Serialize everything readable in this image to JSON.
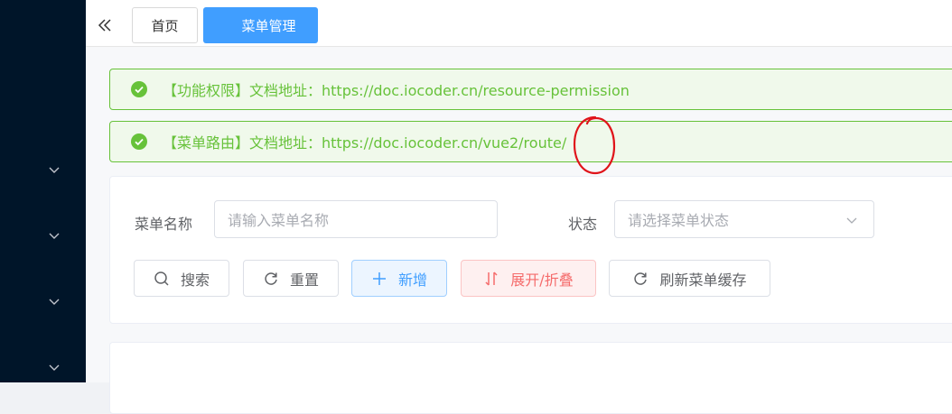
{
  "sidebar": {
    "menu_items": [
      {
        "icon": "chevron-down-icon"
      },
      {
        "icon": "chevron-down-icon"
      },
      {
        "icon": "chevron-down-icon"
      },
      {
        "icon": "chevron-down-icon"
      }
    ]
  },
  "tags": {
    "collapse_icon": "double-chevron-left-icon",
    "home": "首页",
    "active": "菜单管理",
    "active_color": "#409eff"
  },
  "alerts": [
    {
      "text": "【功能权限】文档地址：https://doc.iocoder.cn/resource-permission",
      "icon": "check-circle-icon"
    },
    {
      "text": "【菜单路由】文档地址：https://doc.iocoder.cn/vue2/route/",
      "icon": "check-circle-icon"
    }
  ],
  "search_form": {
    "name_label": "菜单名称",
    "name_placeholder": "请输入菜单名称",
    "status_label": "状态",
    "status_placeholder": "请选择菜单状态"
  },
  "buttons": {
    "search": "搜索",
    "reset": "重置",
    "add": "新增",
    "expand": "展开/折叠",
    "refresh": "刷新菜单缓存"
  },
  "colors": {
    "success": "#67c23a",
    "primary": "#409eff",
    "danger": "#f56c6c",
    "sidebar_bg": "#001529"
  }
}
